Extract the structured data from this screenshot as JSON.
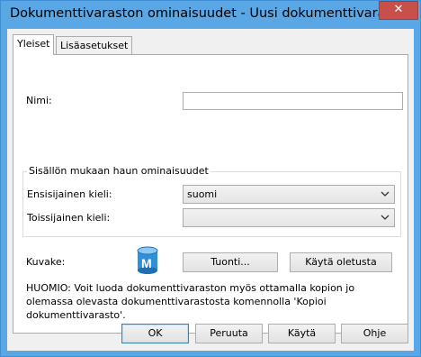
{
  "window": {
    "title": "Dokumenttivaraston ominaisuudet - Uusi dokumenttivarasto",
    "close_glyph": "✕"
  },
  "tabs": [
    {
      "label": "Yleiset",
      "active": true
    },
    {
      "label": "Lisäasetukset",
      "active": false
    }
  ],
  "general": {
    "name_label": "Nimi:",
    "name_value": "",
    "search_group_title": "Sisällön mukaan haun ominaisuudet",
    "primary_language_label": "Ensisijainen kieli:",
    "primary_language_value": "suomi",
    "secondary_language_label": "Toissijainen kieli:",
    "secondary_language_value": "",
    "icon_label": "Kuvake:",
    "icon_name": "database-icon",
    "import_button": "Tuonti...",
    "use_default_button": "Käytä oletusta",
    "note": "HUOMIO: Voit luoda dokumenttivaraston myös ottamalla kopion jo olemassa olevasta dokumenttivarastosta komennolla 'Kopioi dokumenttivarasto'."
  },
  "footer": {
    "ok": "OK",
    "cancel": "Peruuta",
    "apply": "Käytä",
    "help": "Ohje"
  },
  "colors": {
    "titlebar": "#5aa7e6",
    "close_button": "#c7504a",
    "dialog_bg": "#f0f0f0",
    "icon_blue": "#2f8fd8"
  }
}
